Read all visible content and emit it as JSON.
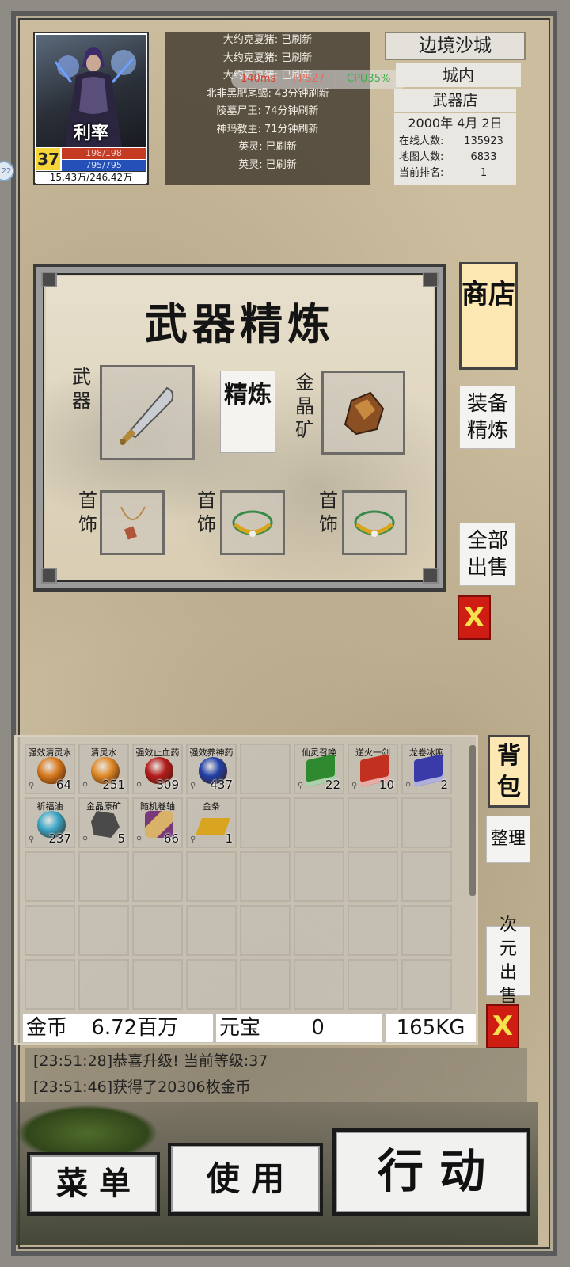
{
  "side_badge": "22",
  "player": {
    "name": "利率",
    "level": "37",
    "hp": "198/198",
    "mp": "795/795",
    "exp": "15.43万/246.42万"
  },
  "boss_list": [
    "大约克夏猪: 已刷新",
    "大约克夏猪: 已刷新",
    "大约克夏猪: 已刷新",
    "北非黑肥尾蝎: 43分钟刷新",
    "陵墓尸王: 74分钟刷新",
    "神玛教主: 71分钟刷新",
    "英灵: 已刷新",
    "英灵: 已刷新"
  ],
  "perf": {
    "ping": "140ms",
    "fps": "FPS27",
    "cpu": "CPU35%"
  },
  "location": {
    "region": "边境沙城",
    "area": "城内",
    "shop": "武器店",
    "date": "2000年 4月 2日",
    "stats": [
      {
        "label": "在线人数:",
        "value": "135923"
      },
      {
        "label": "地图人数:",
        "value": "6833"
      },
      {
        "label": "当前排名:",
        "value": "1"
      }
    ]
  },
  "refine": {
    "title": "武器精炼",
    "weapon_label": "武器",
    "ore_label": "金晶矿",
    "refine_button": "精炼",
    "jewelry_label": "首饰"
  },
  "side_buttons": {
    "shop": "商店",
    "equip_refine": "装备精炼",
    "sell_all": "全部出售",
    "close": "X",
    "bag": "背包",
    "sort": "整理",
    "sell_dim": "次元出售",
    "close2": "X"
  },
  "bag_items": [
    {
      "name": "强效清灵水",
      "count": "64",
      "icon": "orange-potion-icon",
      "color": "#d97a1e"
    },
    {
      "name": "清灵水",
      "count": "251",
      "icon": "orange-potion-icon",
      "color": "#e08a28"
    },
    {
      "name": "强效止血药",
      "count": "309",
      "icon": "red-potion-icon",
      "color": "#b41c1c"
    },
    {
      "name": "强效养神药",
      "count": "437",
      "icon": "blue-potion-icon",
      "color": "#2040a8"
    },
    {
      "name": "",
      "count": "",
      "icon": "",
      "color": ""
    },
    {
      "name": "仙灵召唤",
      "count": "22",
      "icon": "green-book-icon",
      "color": "#2f8a2f"
    },
    {
      "name": "逆火一剑",
      "count": "10",
      "icon": "red-book-icon",
      "color": "#c23020"
    },
    {
      "name": "龙卷冰咆",
      "count": "2",
      "icon": "blue-book-icon",
      "color": "#3a3aa8"
    },
    {
      "name": "祈福油",
      "count": "237",
      "icon": "cyan-flask-icon",
      "color": "#3aa6c8"
    },
    {
      "name": "金晶原矿",
      "count": "5",
      "icon": "ore-icon",
      "color": "#4a4a4a"
    },
    {
      "name": "随机卷轴",
      "count": "66",
      "icon": "scroll-icon",
      "color": "#7a3a7a"
    },
    {
      "name": "金条",
      "count": "1",
      "icon": "gold-bar-icon",
      "color": "#d9a520"
    }
  ],
  "currency": {
    "gold_label": "金币",
    "gold_value": "6.72百万",
    "ingot_label": "元宝",
    "ingot_value": "0",
    "weight": "165KG"
  },
  "log": [
    "[23:51:28]恭喜升级! 当前等级:37",
    "[23:51:46]获得了20306枚金币"
  ],
  "bottom_buttons": {
    "menu": "菜 单",
    "use": "使 用",
    "action": "行 动"
  }
}
